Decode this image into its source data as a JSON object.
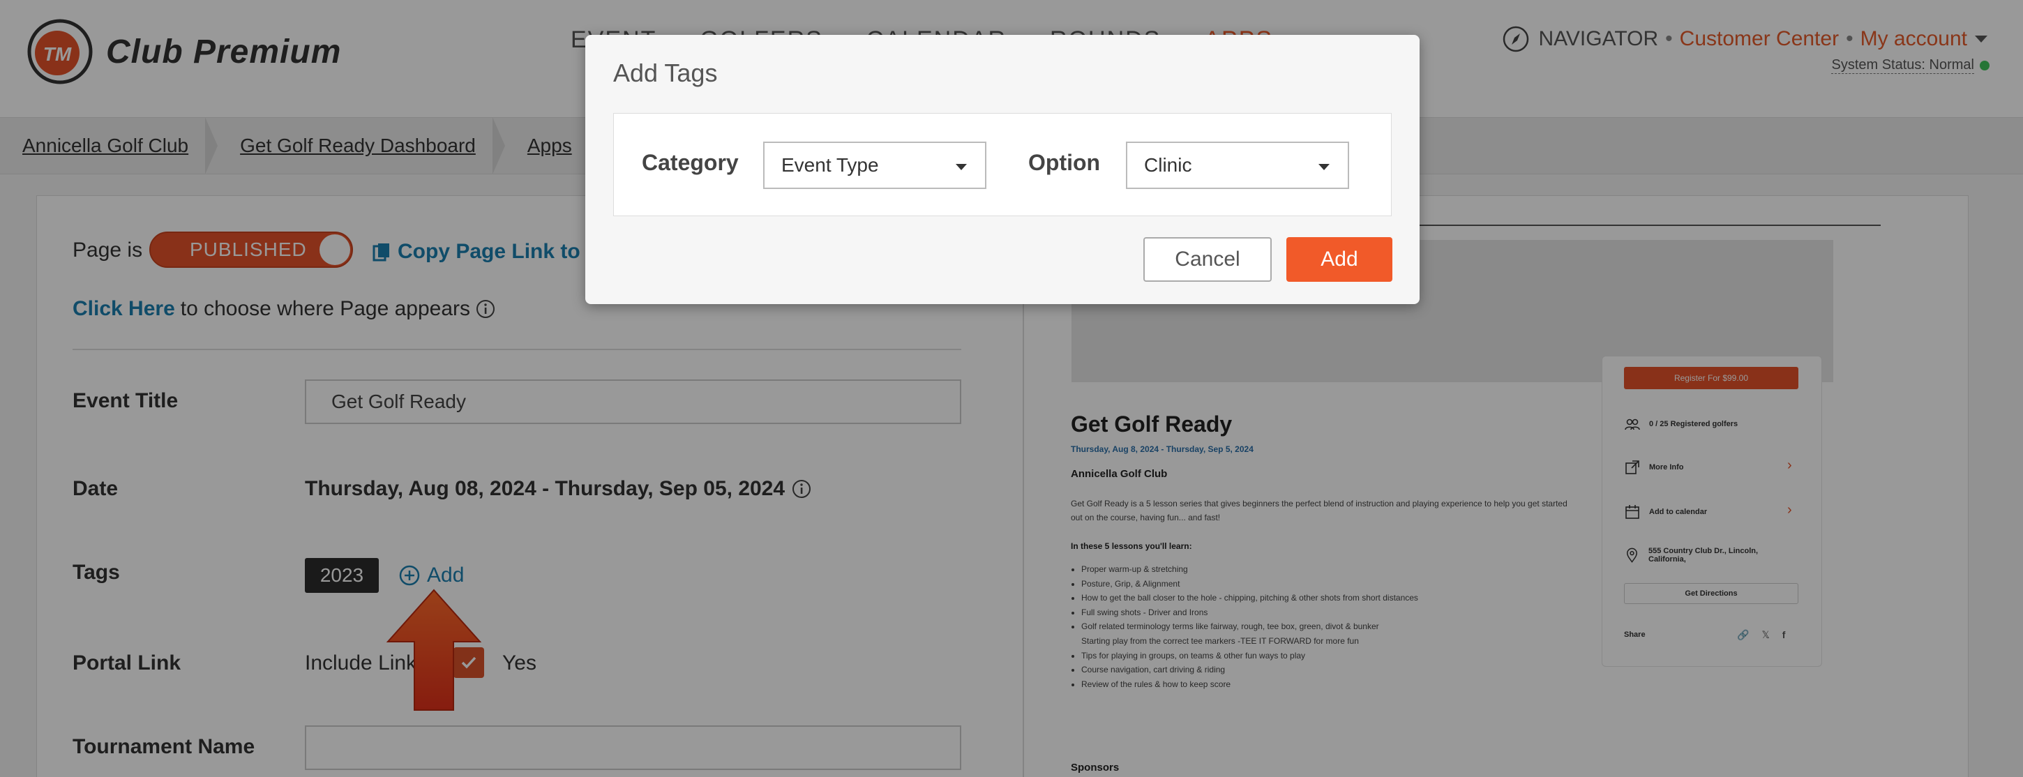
{
  "header": {
    "brand": "Club Premium",
    "logo_initials": "TM",
    "nav": [
      "EVENT",
      "GOLFERS",
      "CALENDAR",
      "ROUNDS",
      "APPS"
    ],
    "active_nav": "APPS",
    "navigator": "NAVIGATOR",
    "separator": "•",
    "customer_center": "Customer Center",
    "my_account": "My account",
    "system_status": "System Status: Normal"
  },
  "breadcrumb": [
    "Annicella Golf Club",
    "Get Golf Ready Dashboard",
    "Apps"
  ],
  "page_status": {
    "label": "Page is",
    "toggle": "PUBLISHED",
    "copy_link": "Copy Page Link to Cli",
    "click_here": "Click Here",
    "click_here_rest": "to choose where Page appears"
  },
  "form": {
    "event_title_label": "Event Title",
    "event_title_value": "Get Golf Ready",
    "date_label": "Date",
    "date_value": "Thursday, Aug 08, 2024 - Thursday, Sep 05, 2024",
    "tags_label": "Tags",
    "tag_chip": "2023",
    "add_tag": "Add",
    "portal_link_label": "Portal Link",
    "include_link": "Include Link?",
    "yes": "Yes",
    "tournament_name_label": "Tournament Name",
    "tournament_name_value": ""
  },
  "preview": {
    "title": "Get Golf Ready",
    "date": "Thursday, Aug 8, 2024 - Thursday, Sep 5, 2024",
    "club": "Annicella Golf Club",
    "description": "Get Golf Ready is a 5 lesson series that gives beginners the perfect blend of instruction and playing experience to help you get started out on the course, having fun... and fast!",
    "lessons_heading": "In these 5 lessons you'll learn:",
    "lessons": [
      "Proper warm-up & stretching",
      "Posture, Grip, & Alignment",
      "How to get the ball closer to the hole - chipping, pitching & other shots from short distances",
      "Full swing shots - Driver and Irons",
      "Golf related terminology terms like fairway, rough, tee box, green, divot & bunker",
      "Starting play from the correct tee markers -TEE IT FORWARD for more fun",
      "Tips for playing in groups, on teams & other fun ways to play",
      "Course navigation, cart driving & riding",
      "Review of the rules & how to keep score"
    ],
    "sponsors": "Sponsors",
    "side": {
      "register": "Register For $99.00",
      "registered": "0 / 25 Registered golfers",
      "more_info": "More Info",
      "add_calendar": "Add to calendar",
      "address": "555 Country Club Dr., Lincoln, California,",
      "directions": "Get Directions",
      "share": "Share"
    }
  },
  "modal": {
    "title": "Add Tags",
    "category_label": "Category",
    "category_value": "Event Type",
    "option_label": "Option",
    "option_value": "Clinic",
    "cancel": "Cancel",
    "add": "Add"
  },
  "colors": {
    "accent": "#f15a29",
    "link": "#1b7fb0",
    "status_ok": "#3ec45b"
  }
}
